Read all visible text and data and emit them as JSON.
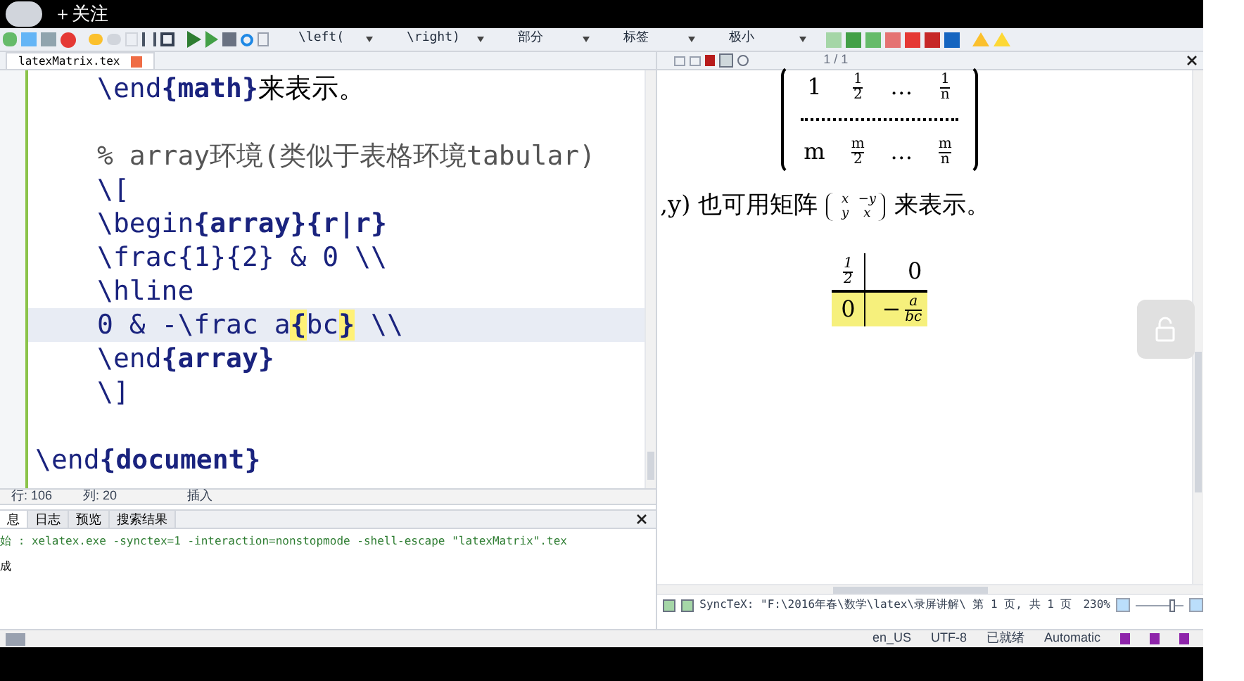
{
  "overlay_bar": {
    "follow_label": "＋关注"
  },
  "toolbar": {
    "dropdowns": [
      "\\left(",
      "\\right)",
      "部分",
      "标签",
      "极小"
    ]
  },
  "editor": {
    "tabs": [
      {
        "label": "latexMatrix.tex",
        "selected": true
      }
    ],
    "lines": [
      {
        "indented": true,
        "gap_before": false,
        "selected": false,
        "tokens": [
          {
            "kind": "command",
            "text": "\\end"
          },
          {
            "kind": "arg",
            "text": "{math}"
          },
          {
            "kind": "text",
            "text": "来表示。"
          }
        ]
      },
      {
        "indented": true,
        "gap_before": true,
        "selected": false,
        "tokens": [
          {
            "kind": "comment",
            "text": "% array环境(类似于表格环境tabular)"
          }
        ]
      },
      {
        "indented": true,
        "gap_before": false,
        "selected": false,
        "tokens": [
          {
            "kind": "command",
            "text": "\\["
          }
        ]
      },
      {
        "indented": true,
        "gap_before": false,
        "selected": false,
        "tokens": [
          {
            "kind": "command",
            "text": "\\begin"
          },
          {
            "kind": "arg",
            "text": "{array}"
          },
          {
            "kind": "arg",
            "text": "{r|r}"
          }
        ]
      },
      {
        "indented": true,
        "gap_before": false,
        "selected": false,
        "tokens": [
          {
            "kind": "command",
            "text": "\\frac{1}{2} & 0 \\\\"
          }
        ]
      },
      {
        "indented": true,
        "gap_before": false,
        "selected": false,
        "tokens": [
          {
            "kind": "command",
            "text": "\\hline"
          }
        ]
      },
      {
        "indented": true,
        "gap_before": false,
        "selected": true,
        "tokens": [
          {
            "kind": "command",
            "text": "0 & -\\frac a"
          },
          {
            "kind": "match",
            "text": "{"
          },
          {
            "kind": "command",
            "text": "bc"
          },
          {
            "kind": "match",
            "text": "}"
          },
          {
            "kind": "command",
            "text": " \\\\"
          }
        ]
      },
      {
        "indented": true,
        "gap_before": false,
        "selected": false,
        "tokens": [
          {
            "kind": "command",
            "text": "\\end"
          },
          {
            "kind": "arg",
            "text": "{array}"
          }
        ]
      },
      {
        "indented": true,
        "gap_before": false,
        "selected": false,
        "tokens": [
          {
            "kind": "command",
            "text": "\\]"
          }
        ]
      },
      {
        "indented": false,
        "gap_before": true,
        "selected": false,
        "tokens": [
          {
            "kind": "command",
            "text": "\\end"
          },
          {
            "kind": "arg",
            "text": "{document}"
          }
        ]
      }
    ]
  },
  "editor_status": {
    "line": "行: 106",
    "column": "列: 20",
    "mode": "插入"
  },
  "messages": {
    "tabs": [
      {
        "label": "息",
        "selected": true
      },
      {
        "label": "日志",
        "selected": false
      },
      {
        "label": "预览",
        "selected": false
      },
      {
        "label": "搜索结果",
        "selected": false
      }
    ],
    "lines": [
      {
        "kind": "command",
        "text": "始 : xelatex.exe -synctex=1 -interaction=nonstopmode -shell-escape \"latexMatrix\".tex"
      },
      {
        "kind": "plain",
        "text": "成"
      }
    ]
  },
  "preview": {
    "page": "1 / 1",
    "matrix": {
      "rows": [
        [
          {
            "text": "1"
          },
          {
            "num": "1",
            "den": "2"
          },
          {
            "text": "…"
          },
          {
            "num": "1",
            "den": "n"
          }
        ],
        [
          {
            "text": "m"
          },
          {
            "num": "m",
            "den": "2"
          },
          {
            "text": "…"
          },
          {
            "num": "m",
            "den": "n"
          }
        ]
      ]
    },
    "sentence": {
      "before": ",y) 也可用矩阵",
      "small_matrix": [
        [
          "x",
          "−y"
        ],
        [
          "y",
          "x"
        ]
      ],
      "after": "来表示。"
    },
    "table": {
      "rows": [
        {
          "highlighted": false,
          "cells": [
            {
              "num": "1",
              "den": "2"
            },
            {
              "text": "0"
            }
          ]
        },
        {
          "highlighted": true,
          "cells": [
            {
              "text": "0"
            },
            {
              "sign": "−",
              "num": "a",
              "den": "bc"
            }
          ]
        }
      ]
    },
    "sync": "SyncTeX: \"F:\\2016年春\\数学\\latex\\录屏讲解\\ 第 1 页, 共 1 页",
    "zoom": "230%",
    "zoom_slider": {
      "level": 0.8
    }
  },
  "status_bar": [
    "en_US",
    "UTF-8",
    "已就绪",
    "Automatic"
  ]
}
